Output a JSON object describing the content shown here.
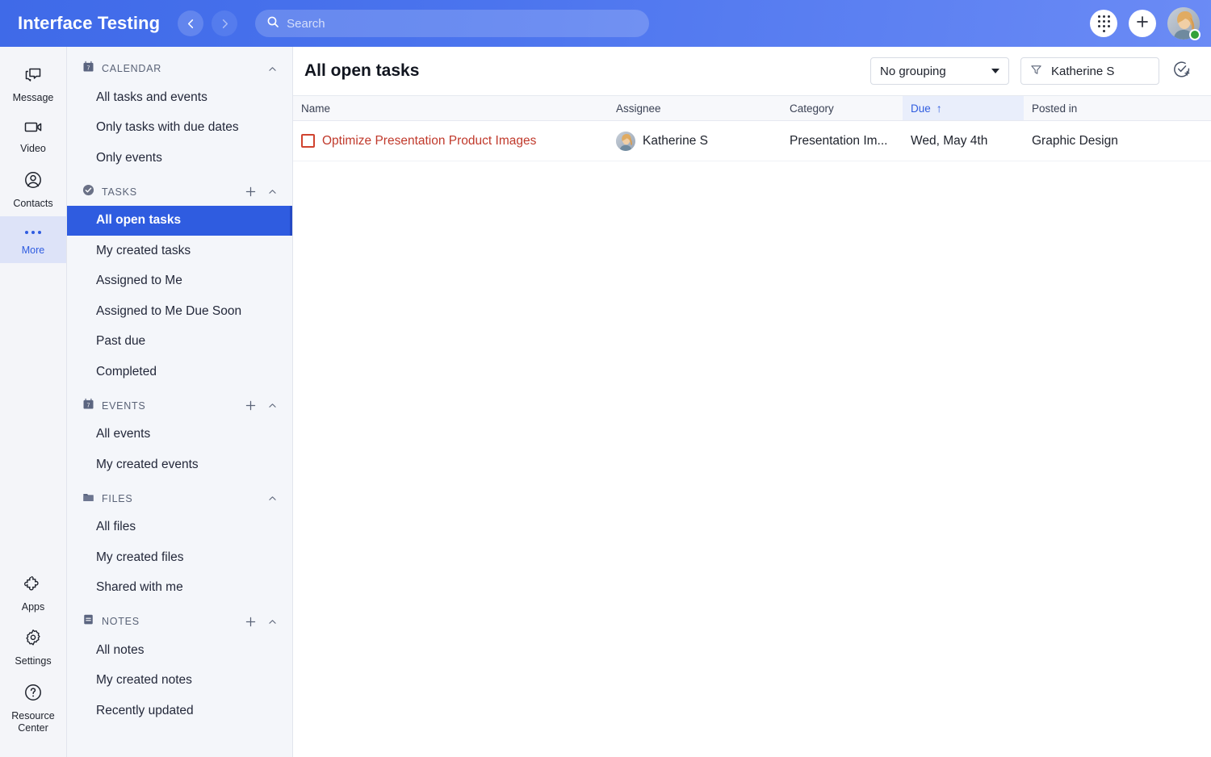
{
  "header": {
    "brand": "Interface Testing",
    "back_icon": "chevron-left-icon",
    "forward_icon": "chevron-right-icon",
    "search": {
      "placeholder": "Search",
      "value": "",
      "icon": "search-icon"
    },
    "apps_grid_icon": "dialpad-grid-icon",
    "add_icon": "plus-icon",
    "avatar_icon": "user-avatar",
    "status": "online",
    "accent_color": "#4b74ee"
  },
  "rail": {
    "items": [
      {
        "label": "Message",
        "icon": "chat-bubble-icon",
        "active": false
      },
      {
        "label": "Video",
        "icon": "video-camera-icon",
        "active": false
      },
      {
        "label": "Contacts",
        "icon": "user-circle-icon",
        "active": false
      },
      {
        "label": "More",
        "icon": "ellipsis-icon",
        "active": true
      }
    ],
    "bottom_items": [
      {
        "label": "Apps",
        "icon": "puzzle-piece-icon"
      },
      {
        "label": "Settings",
        "icon": "gear-icon"
      },
      {
        "label": "Resource Center",
        "icon": "question-circle-icon"
      }
    ]
  },
  "sidebar": {
    "sections": [
      {
        "title": "CALENDAR",
        "icon": "calendar-icon",
        "has_add": false,
        "collapse_icon": "chevron-up-icon",
        "items": [
          {
            "label": "All tasks and events",
            "active": false
          },
          {
            "label": "Only tasks with due dates",
            "active": false
          },
          {
            "label": "Only events",
            "active": false
          }
        ]
      },
      {
        "title": "TASKS",
        "icon": "check-circle-icon",
        "has_add": true,
        "collapse_icon": "chevron-up-icon",
        "items": [
          {
            "label": "All open tasks",
            "active": true
          },
          {
            "label": "My created tasks",
            "active": false
          },
          {
            "label": "Assigned to Me",
            "active": false
          },
          {
            "label": "Assigned to Me Due Soon",
            "active": false
          },
          {
            "label": "Past due",
            "active": false
          },
          {
            "label": "Completed",
            "active": false
          }
        ]
      },
      {
        "title": "EVENTS",
        "icon": "calendar-icon",
        "has_add": true,
        "collapse_icon": "chevron-up-icon",
        "items": [
          {
            "label": "All events",
            "active": false
          },
          {
            "label": "My created events",
            "active": false
          }
        ]
      },
      {
        "title": "FILES",
        "icon": "folder-icon",
        "has_add": false,
        "collapse_icon": "chevron-up-icon",
        "items": [
          {
            "label": "All files",
            "active": false
          },
          {
            "label": "My created files",
            "active": false
          },
          {
            "label": "Shared with me",
            "active": false
          }
        ]
      },
      {
        "title": "NOTES",
        "icon": "note-icon",
        "has_add": true,
        "collapse_icon": "chevron-up-icon",
        "items": [
          {
            "label": "All notes",
            "active": false
          },
          {
            "label": "My created notes",
            "active": false
          },
          {
            "label": "Recently updated",
            "active": false
          }
        ]
      }
    ]
  },
  "main": {
    "page_title": "All open tasks",
    "toolbar": {
      "grouping_value": "No grouping",
      "grouping_caret_icon": "caret-down-icon",
      "filter_icon": "funnel-icon",
      "filter_value": "Katherine S",
      "add_task_icon": "check-circle-plus-icon"
    },
    "table": {
      "columns": [
        {
          "label": "Name",
          "sorted": false
        },
        {
          "label": "Assignee",
          "sorted": false
        },
        {
          "label": "Category",
          "sorted": false
        },
        {
          "label": "Due",
          "sorted": true,
          "sort_dir": "↑"
        },
        {
          "label": "Posted in",
          "sorted": false
        }
      ],
      "rows": [
        {
          "checked": false,
          "checkbox_color": "#d0432f",
          "name": "Optimize Presentation Product Images",
          "name_color": "#c0392b",
          "assignee": "Katherine S",
          "assignee_avatar": "user-avatar",
          "category": "Presentation Im...",
          "due": "Wed, May 4th",
          "posted_in": "Graphic Design"
        }
      ]
    }
  }
}
